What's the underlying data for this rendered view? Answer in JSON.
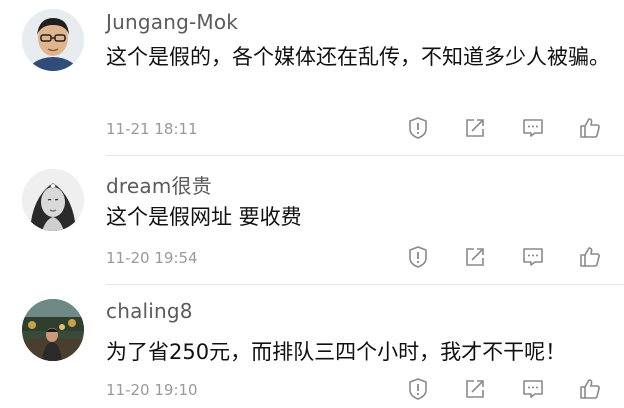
{
  "comments": [
    {
      "username": "Jungang-Mok",
      "text": "这个是假的，各个媒体还在乱传，不知道多少人被骗。",
      "time": "11-21 18:11"
    },
    {
      "username": "dream很贵",
      "text": "这个是假网址 要收费",
      "time": "11-20 19:54"
    },
    {
      "username": "chaling8",
      "text": "为了省250元，而排队三四个小时，我才不干呢！",
      "time": "11-20 19:10"
    }
  ],
  "icons": [
    "report-icon",
    "share-icon",
    "reply-icon",
    "like-icon"
  ],
  "colors": {
    "username": "#5b5b5b",
    "text": "#111111",
    "meta": "#9a9a9a",
    "icon": "#8a8a8a"
  }
}
